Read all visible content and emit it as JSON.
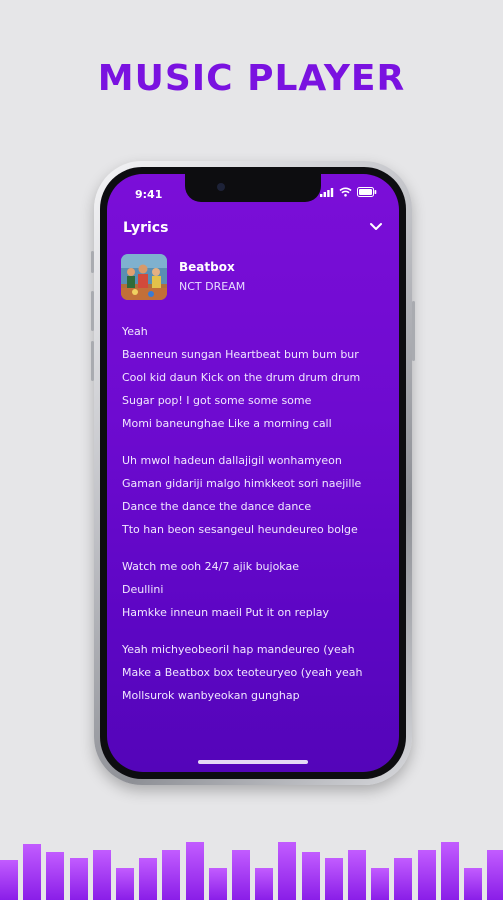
{
  "headline": "MUSIC PLAYER",
  "accent_color": "#7a12e0",
  "screen_gradient": [
    "#7b0ed8",
    "#5405b9"
  ],
  "status_bar": {
    "time": "9:41",
    "icons": [
      "cellular-signal-icon",
      "wifi-icon",
      "battery-icon"
    ]
  },
  "panel": {
    "title": "Lyrics",
    "collapse_icon": "chevron-down-icon"
  },
  "now_playing": {
    "title": "Beatbox",
    "artist": "NCT DREAM",
    "cover_icon": "album-cover-image"
  },
  "lyrics": [
    [
      "Yeah",
      "Baenneun sungan Heartbeat bum bum bur",
      "Cool kid daun Kick on the drum drum drum",
      "Sugar pop! I got some some some",
      "Momi baneunghae Like a morning call"
    ],
    [
      "Uh mwol hadeun dallajigil wonhamyeon",
      "Gaman gidariji malgo himkkeot sori naejille",
      "Dance the dance the dance dance",
      "Tto han beon sesangeul heundeureo bolge"
    ],
    [
      "Watch me ooh 24/7 ajik bujokae",
      "Deullini",
      "Hamkke inneun maeil Put it on replay"
    ],
    [
      "Yeah michyeobeoril hap mandeureo (yeah",
      "Make a Beatbox box teoteuryeo (yeah yeah",
      "Mollsurok wanbyeokan gunghap"
    ]
  ],
  "equalizer_levels": [
    0.55,
    0.78,
    0.66,
    0.58,
    0.7,
    0.44,
    0.58,
    0.7,
    0.8,
    0.44,
    0.7,
    0.44,
    0.8,
    0.66,
    0.58,
    0.7,
    0.44,
    0.58,
    0.7,
    0.8,
    0.44,
    0.7
  ]
}
